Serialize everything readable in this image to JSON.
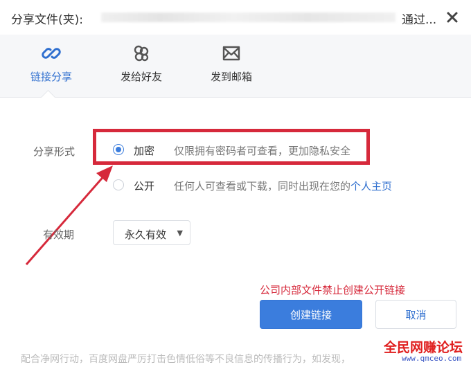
{
  "header": {
    "title": "分享文件(夹):",
    "title_suffix": "通过...",
    "close_icon": "close-icon"
  },
  "tabs": [
    {
      "label": "链接分享",
      "icon": "link-icon",
      "active": true
    },
    {
      "label": "发给好友",
      "icon": "friends-icon",
      "active": false
    },
    {
      "label": "发到邮箱",
      "icon": "mail-icon",
      "active": false
    }
  ],
  "form": {
    "share_type_label": "分享形式",
    "options": [
      {
        "title": "加密",
        "desc": "仅限拥有密码者可查看，更加隐私安全",
        "checked": true
      },
      {
        "title": "公开",
        "desc": "任何人可查看或下载，同时出现在您的",
        "link": "个人主页",
        "checked": false
      }
    ],
    "expire_label": "有效期",
    "expire_value": "永久有效",
    "expire_caret": "▼"
  },
  "warning": "公司内部文件禁止创建公开链接",
  "buttons": {
    "create": "创建链接",
    "cancel": "取消"
  },
  "footer": "配合净网行动，百度网盘严厉打击色情低俗等不良信息的传播行为，如发现，",
  "watermark": {
    "main": "全民网赚论坛",
    "sub": "www.qmceo.com"
  },
  "colors": {
    "accent": "#3b7ddd",
    "annotation_red": "#d6293b"
  }
}
